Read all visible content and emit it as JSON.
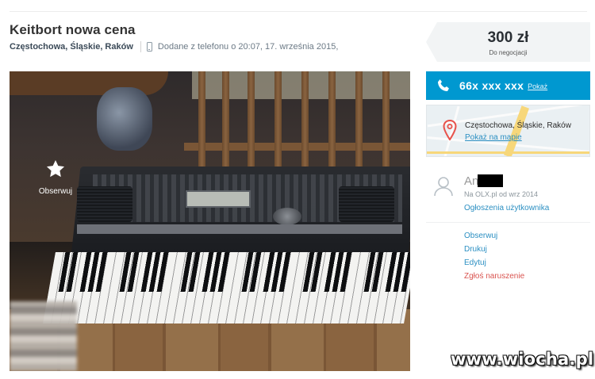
{
  "listing": {
    "title": "Keitbort nowa cena",
    "location": "Częstochowa, Śląskie, Raków",
    "added": "Dodane z telefonu o 20:07, 17. września 2015,"
  },
  "photo": {
    "observe_label": "Obserwuj",
    "icon": "star-icon"
  },
  "price": {
    "amount": "300 zł",
    "note": "Do negocjacji"
  },
  "contact": {
    "phone": "66x xxx xxx",
    "show_label": "Pokaż",
    "icon": "phone-icon"
  },
  "map": {
    "location": "Częstochowa, Śląskie, Raków",
    "link": "Pokaż na mapie",
    "icon": "location-pin-icon"
  },
  "seller": {
    "name": "An",
    "since": "Na OLX.pl od wrz 2014",
    "ads_link": "Ogłoszenia użytkownika",
    "icon": "user-icon"
  },
  "actions": {
    "observe": "Obserwuj",
    "print": "Drukuj",
    "edit": "Edytuj",
    "report": "Zgłoś naruszenie"
  },
  "watermark": "www.wiocha.pl",
  "colors": {
    "accent": "#0098d0",
    "link": "#2b8fc2",
    "report": "#d9534f"
  }
}
